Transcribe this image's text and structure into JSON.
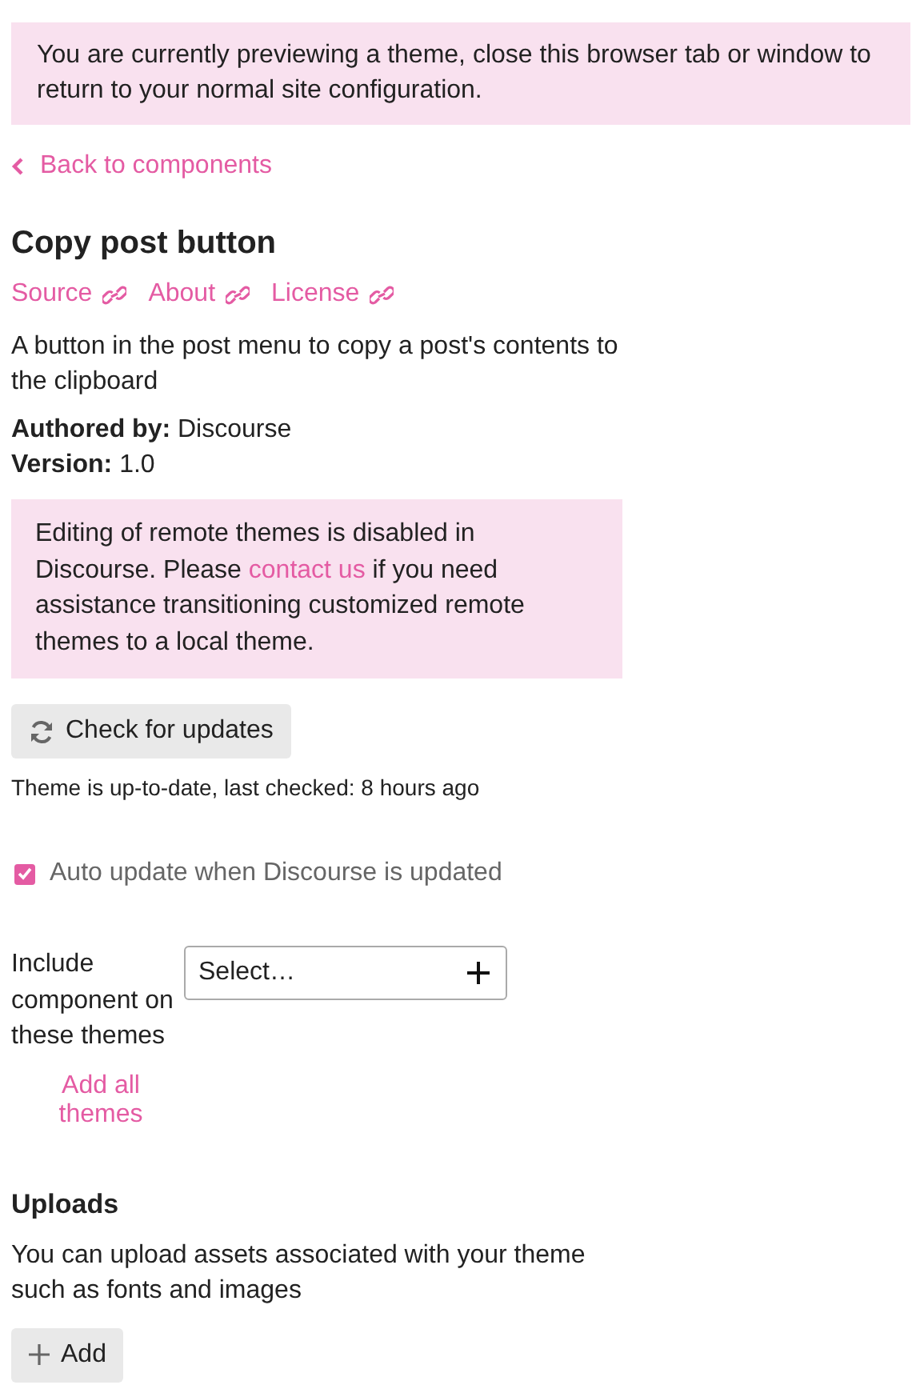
{
  "preview_banner": {
    "text": "You are currently previewing a theme, close this browser tab or window to return to your normal site configuration."
  },
  "back_link": {
    "label": "Back to components"
  },
  "title": "Copy post button",
  "links": [
    {
      "label": "Source"
    },
    {
      "label": "About"
    },
    {
      "label": "License"
    }
  ],
  "description": "A button in the post menu to copy a post's contents to the clipboard",
  "meta": [
    {
      "label": "Authored by:",
      "value": "Discourse"
    },
    {
      "label": "Version:",
      "value": "1.0"
    }
  ],
  "remote_notice": {
    "before": "Editing of remote themes is disabled in Discourse. Please ",
    "link": "contact us",
    "after": " if you need assistance transitioning customized remote themes to a local theme."
  },
  "check_button": {
    "label": "Check for updates"
  },
  "update_status": "Theme is up-to-date, last checked: 8 hours ago",
  "auto_update": {
    "label": "Auto update when Discourse is updated",
    "checked": true
  },
  "include": {
    "label": "Include component on these themes",
    "placeholder": "Select…",
    "add_all": "Add all themes"
  },
  "uploads": {
    "title": "Uploads",
    "description": "You can upload assets associated with your theme such as fonts and images",
    "button": "Add"
  }
}
